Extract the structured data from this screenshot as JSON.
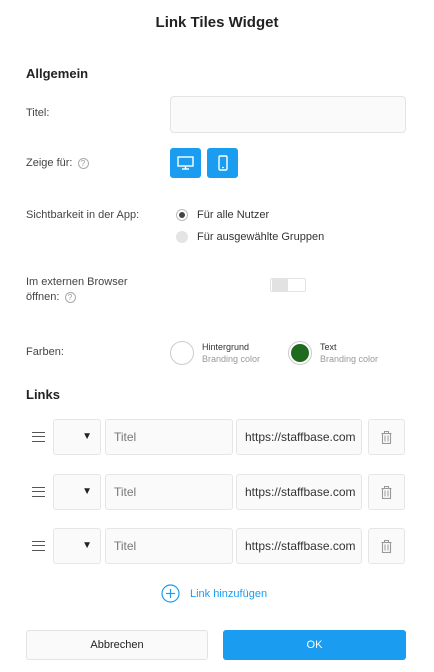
{
  "dialog": {
    "title": "Link Tiles Widget"
  },
  "general": {
    "heading": "Allgemein",
    "title_label": "Titel:",
    "title_value": "",
    "show_for_label": "Zeige für:",
    "help_glyph": "?",
    "visibility_label": "Sichtbarkeit in der App:",
    "visibility_options": [
      {
        "label": "Für alle Nutzer",
        "selected": true
      },
      {
        "label": "Für ausgewählte Gruppen",
        "selected": false
      }
    ],
    "external_label_line1": "Im externen Browser",
    "external_label_line2": "öffnen:",
    "external_toggle_on": false,
    "colors_label": "Farben:",
    "background": {
      "title": "Hintergrund",
      "subtitle": "Branding color",
      "color": "#ffffff"
    },
    "text": {
      "title": "Text",
      "subtitle": "Branding color",
      "color": "#1e6b1e"
    }
  },
  "links": {
    "heading": "Links",
    "title_placeholder": "Titel",
    "items": [
      {
        "icon": "",
        "title": "",
        "url": "https://staffbase.com"
      },
      {
        "icon": "",
        "title": "",
        "url": "https://staffbase.com"
      },
      {
        "icon": "",
        "title": "",
        "url": "https://staffbase.com"
      }
    ],
    "add_label": "Link hinzufügen"
  },
  "footer": {
    "cancel_label": "Abbrechen",
    "ok_label": "OK"
  },
  "colors": {
    "accent": "#1a9df0"
  }
}
